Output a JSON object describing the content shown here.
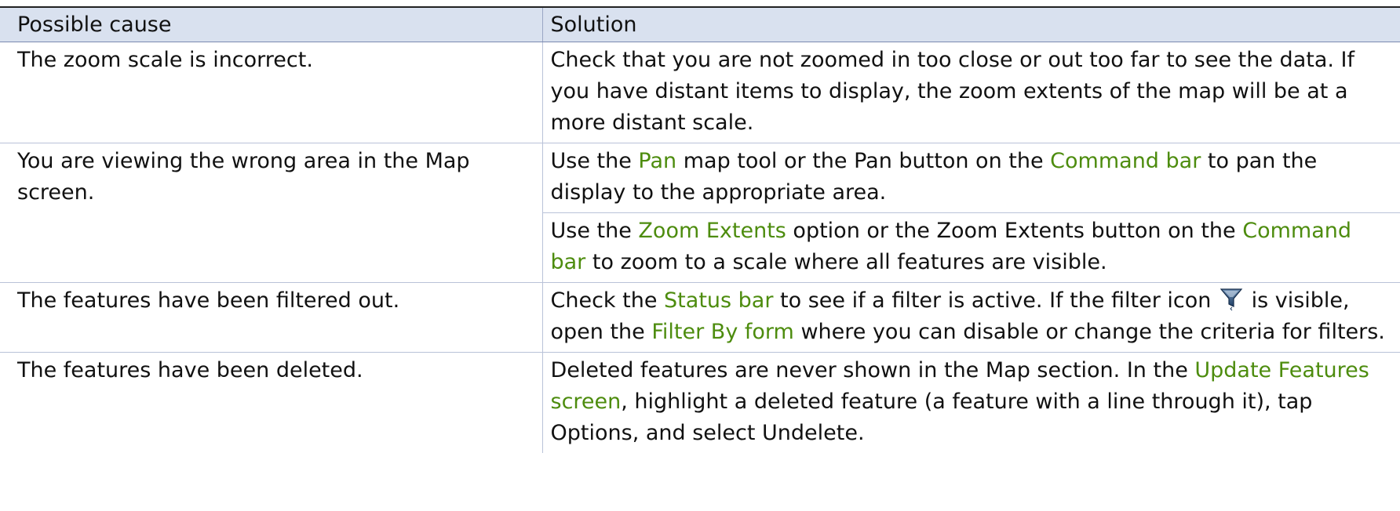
{
  "table": {
    "headers": {
      "cause": "Possible cause",
      "solution": "Solution"
    },
    "rows": [
      {
        "cause": "The zoom scale is incorrect.",
        "solution": "Check that you are not zoomed in too close or out too far to see the data. If you have distant items to display, the zoom extents of the map will be at a more distant scale."
      },
      {
        "cause": "You are viewing the wrong area in the Map screen.",
        "solution_parts": [
          "Use the ",
          "Pan",
          " map tool or the Pan button on the ",
          "Command bar",
          " to pan the display to the appropriate area."
        ]
      },
      {
        "cause": "",
        "solution_parts": [
          "Use the ",
          "Zoom Extents",
          " option or the Zoom Extents button on the ",
          "Command bar",
          " to zoom to a scale where all features are visible."
        ]
      },
      {
        "cause": "The features have been filtered out.",
        "solution_parts": [
          "Check the ",
          "Status bar",
          " to see if a filter is active. If the filter icon ",
          " is visible, open the ",
          "Filter By form",
          " where you can disable or change the criteria for filters."
        ]
      },
      {
        "cause": "The features have been deleted.",
        "solution_parts": [
          "Deleted features are never shown in the Map section. In the ",
          "Update Features screen",
          ", highlight a deleted feature (a feature with a line through it), tap ",
          "Options",
          ", and select Undelete."
        ]
      }
    ]
  },
  "icons": {
    "filter": "filter-funnel-icon"
  },
  "colors": {
    "link_green": "#4d8c0e",
    "header_bg": "#d9e1ef"
  }
}
